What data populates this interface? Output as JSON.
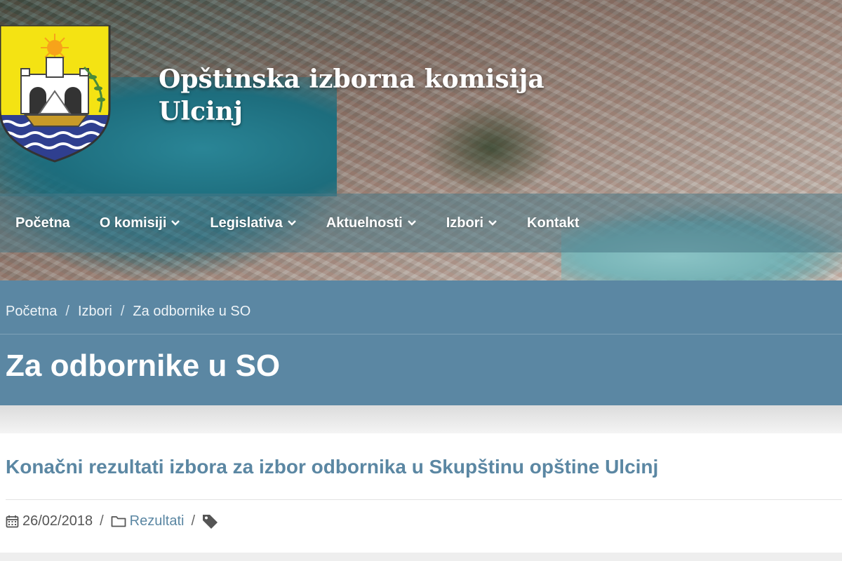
{
  "site": {
    "title_line1": "Opštinska izborna komisija",
    "title_line2": "Ulcinj"
  },
  "nav": [
    {
      "label": "Početna",
      "has_dropdown": false
    },
    {
      "label": "O komisiji",
      "has_dropdown": true
    },
    {
      "label": "Legislativa",
      "has_dropdown": true
    },
    {
      "label": "Aktuelnosti",
      "has_dropdown": true
    },
    {
      "label": "Izbori",
      "has_dropdown": true
    },
    {
      "label": "Kontakt",
      "has_dropdown": false
    }
  ],
  "breadcrumb": {
    "items": [
      "Početna",
      "Izbori",
      "Za odbornike u SO"
    ],
    "separator": "/"
  },
  "page": {
    "title": "Za odbornike u SO"
  },
  "article": {
    "title": "Konačni rezultati izbora za izbor odbornika u Skupštinu opštine Ulcinj",
    "date": "26/02/2018",
    "category": "Rezultati",
    "separator": "/"
  },
  "icons": {
    "logo": "coat-of-arms-ulcinj",
    "chevron": "chevron-down-icon",
    "date": "calendar-icon",
    "category": "folder-icon",
    "tags": "tag-icon"
  },
  "colors": {
    "band": "#5b87a3",
    "accent": "#5b87a3",
    "text_muted": "#555555"
  }
}
